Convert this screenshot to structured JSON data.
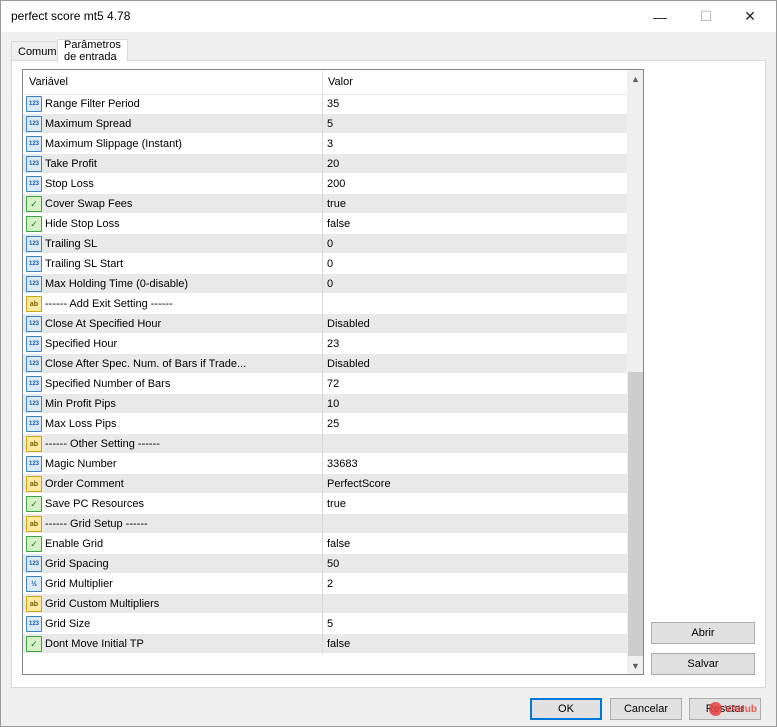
{
  "window": {
    "title": "perfect score mt5 4.78",
    "minimize": "—",
    "maximize": "☐",
    "close": "✕"
  },
  "tabs": [
    {
      "label": "Comum",
      "active": false
    },
    {
      "label": "Parâmetros de entrada",
      "active": true
    }
  ],
  "grid": {
    "columns": [
      "Variável",
      "Valor"
    ],
    "scroll_up": "▲",
    "scroll_down": "▼",
    "rows": [
      {
        "type": "num",
        "icon": "123",
        "name": "Range Filter Period",
        "value": "35"
      },
      {
        "type": "num",
        "icon": "123",
        "name": "Maximum Spread",
        "value": "5"
      },
      {
        "type": "num",
        "icon": "123",
        "name": "Maximum Slippage (Instant)",
        "value": "3"
      },
      {
        "type": "num",
        "icon": "123",
        "name": "Take Profit",
        "value": "20"
      },
      {
        "type": "num",
        "icon": "123",
        "name": "Stop Loss",
        "value": "200"
      },
      {
        "type": "bool",
        "icon": "✓",
        "name": "Cover Swap Fees",
        "value": "true"
      },
      {
        "type": "bool",
        "icon": "✓",
        "name": "Hide Stop Loss",
        "value": "false"
      },
      {
        "type": "num",
        "icon": "123",
        "name": "Trailing SL",
        "value": "0"
      },
      {
        "type": "num",
        "icon": "123",
        "name": "Trailing SL Start",
        "value": "0"
      },
      {
        "type": "num",
        "icon": "123",
        "name": "Max Holding Time (0-disable)",
        "value": "0"
      },
      {
        "type": "str",
        "icon": "ab",
        "name": "------ Add Exit Setting ------",
        "value": ""
      },
      {
        "type": "num",
        "icon": "123",
        "name": "Close At Specified Hour",
        "value": "Disabled"
      },
      {
        "type": "num",
        "icon": "123",
        "name": "Specified Hour",
        "value": "23"
      },
      {
        "type": "num",
        "icon": "123",
        "name": "Close After Spec. Num. of Bars if Trade...",
        "value": "Disabled"
      },
      {
        "type": "num",
        "icon": "123",
        "name": "Specified Number of Bars",
        "value": "72"
      },
      {
        "type": "num",
        "icon": "123",
        "name": "Min Profit Pips",
        "value": "10"
      },
      {
        "type": "num",
        "icon": "123",
        "name": "Max Loss Pips",
        "value": "25"
      },
      {
        "type": "str",
        "icon": "ab",
        "name": "------ Other Setting ------",
        "value": ""
      },
      {
        "type": "num",
        "icon": "123",
        "name": "Magic Number",
        "value": "33683"
      },
      {
        "type": "str",
        "icon": "ab",
        "name": "Order Comment",
        "value": "PerfectScore"
      },
      {
        "type": "bool",
        "icon": "✓",
        "name": "Save PC Resources",
        "value": "true"
      },
      {
        "type": "str",
        "icon": "ab",
        "name": "------ Grid Setup ------",
        "value": ""
      },
      {
        "type": "bool",
        "icon": "✓",
        "name": "Enable Grid",
        "value": "false"
      },
      {
        "type": "num",
        "icon": "123",
        "name": "Grid Spacing",
        "value": "50"
      },
      {
        "type": "dbl",
        "icon": "½",
        "name": "Grid Multiplier",
        "value": "2"
      },
      {
        "type": "str",
        "icon": "ab",
        "name": "Grid Custom Multipliers",
        "value": ""
      },
      {
        "type": "num",
        "icon": "123",
        "name": "Grid Size",
        "value": "5"
      },
      {
        "type": "bool",
        "icon": "✓",
        "name": "Dont Move Initial TP",
        "value": "false"
      }
    ]
  },
  "side_buttons": {
    "open": "Abrir",
    "save": "Salvar"
  },
  "footer_buttons": {
    "ok": "OK",
    "cancel": "Cancelar",
    "reset": "Resetar"
  },
  "watermark": {
    "text": "VAHub"
  }
}
